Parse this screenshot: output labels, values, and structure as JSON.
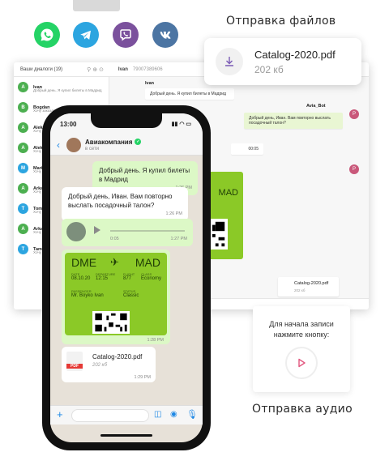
{
  "messengers": [
    {
      "name": "whatsapp",
      "color": "#25d366"
    },
    {
      "name": "telegram",
      "color": "#2ca5e0"
    },
    {
      "name": "viber",
      "color": "#7b519d"
    },
    {
      "name": "vk",
      "color": "#4c75a3"
    }
  ],
  "captions": {
    "files": "Отправка файлов",
    "audio": "Отправка аудио"
  },
  "file_card": {
    "name": "Catalog-2020.pdf",
    "size": "202 кб"
  },
  "audio_card": {
    "line1": "Для начала записи",
    "line2": "нажмите кнопку:"
  },
  "desktop": {
    "dialogs_label": "Ваши диалоги (19)",
    "header_name": "Ivan",
    "header_phone": "79007389606",
    "dialogs": [
      {
        "initial": "A",
        "name": "Ivan",
        "color": "#4caf50",
        "preview": "Добрый день. Я купил билеты в Мадрид"
      },
      {
        "initial": "B",
        "name": "Bogdan",
        "color": "#4caf50",
        "preview": "Хочу заказать"
      },
      {
        "initial": "A",
        "name": "Aleksa",
        "color": "#4caf50",
        "preview": "Хочу"
      },
      {
        "initial": "A",
        "name": "Aleksa",
        "color": "#4caf50",
        "preview": "Хочу"
      },
      {
        "initial": "M",
        "name": "Maria",
        "color": "#2ca5e0",
        "preview": "Хочу"
      },
      {
        "initial": "A",
        "name": "Arkadi",
        "color": "#4caf50",
        "preview": "Хочу"
      },
      {
        "initial": "T",
        "name": "Tomas",
        "color": "#2ca5e0",
        "preview": "Хочу"
      },
      {
        "initial": "A",
        "name": "Arkadi",
        "color": "#4caf50",
        "preview": "Хочу"
      },
      {
        "initial": "T",
        "name": "Taman",
        "color": "#2ca5e0",
        "preview": "Хочу"
      }
    ],
    "chat": {
      "user_name": "Ivan",
      "user_msg": "Добрый день. Я купил билеты в Мадрид",
      "bot_name": "Avia_Bot",
      "bot_msg": "Добрый день, Иван. Вам повторно выслать посадочный талон?",
      "audio_time": "00:05",
      "file_name": "Catalog-2020.pdf",
      "file_size": "202 кб",
      "bot_initial": "P"
    }
  },
  "phone": {
    "time": "13:00",
    "company": "Авиакомпания",
    "status": "в сети",
    "msg1": {
      "text": "Добрый день. Я купил билеты в Мадрид",
      "time": "1:26 PM"
    },
    "msg2": {
      "text": "Добрый день, Иван. Вам повторно выслать посадочный талон?",
      "time": "1:26 PM"
    },
    "audio": {
      "duration": "0:05",
      "time": "1:27 PM"
    },
    "ticket": {
      "from": "DME",
      "to": "MAD",
      "date_label": "DATE",
      "date": "08.10.20",
      "departure_label": "DEPARTURE",
      "departure": "12:15",
      "flight_label": "FLIGHT",
      "flight": "877",
      "class_label": "CLASS",
      "class": "Economy",
      "passenger_label": "PASSENGER",
      "passenger": "Mr. Boyko Ivan",
      "status_label": "STATUS",
      "status": "Classic",
      "time": "1:28 PM"
    },
    "file": {
      "name": "Catalog-2020.pdf",
      "size": "202 кб",
      "time": "1:29 PM",
      "badge": "PDF"
    }
  }
}
